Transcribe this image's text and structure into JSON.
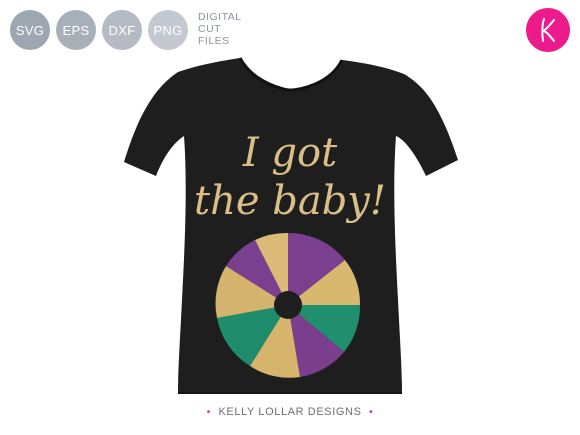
{
  "badges": [
    {
      "label": "SVG"
    },
    {
      "label": "EPS"
    },
    {
      "label": "DXF"
    },
    {
      "label": "PNG"
    }
  ],
  "files_label": {
    "line1": "DIGITAL",
    "line2": "CUT",
    "line3": "FILES"
  },
  "logo": {
    "icon": "kelly-k-logo-icon",
    "color": "#ed1a8c"
  },
  "shirt": {
    "color": "#1e1d1d",
    "text_line1": "I got",
    "text_line2": "the baby!",
    "text_color": "#d9bf86",
    "cake_colors": [
      "#d4b46c",
      "#7a3f8e",
      "#1f8c6c"
    ]
  },
  "footer": {
    "brand": "KELLY LOLLAR DESIGNS",
    "dot": "•"
  }
}
